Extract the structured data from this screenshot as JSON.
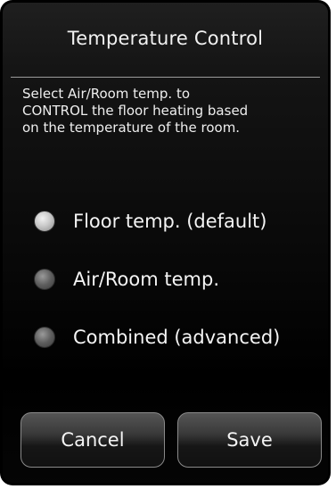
{
  "header": {
    "title": "Temperature Control"
  },
  "description": {
    "lines": [
      "Select Air/Room temp. to",
      "CONTROL the floor heating based",
      "on the temperature of the room."
    ]
  },
  "options": [
    {
      "label": "Floor temp. (default)",
      "selected": true
    },
    {
      "label": "Air/Room temp.",
      "selected": false
    },
    {
      "label": "Combined (advanced)",
      "selected": false
    }
  ],
  "buttons": {
    "cancel_label": "Cancel",
    "save_label": "Save"
  }
}
